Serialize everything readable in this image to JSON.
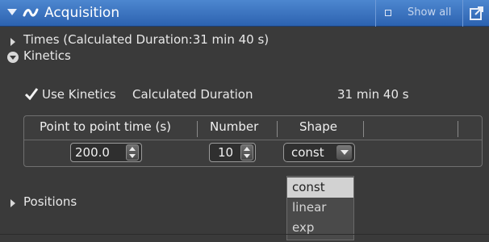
{
  "panel": {
    "title": "Acquisition",
    "show_all_label": "Show all"
  },
  "tree": {
    "times_label": "Times (Calculated Duration:31 min 40 s)",
    "kinetics_label": "Kinetics",
    "positions_label": "Positions"
  },
  "kinetics": {
    "use_kinetics_label": "Use Kinetics",
    "use_kinetics_checked": true,
    "calc_duration_label": "Calculated Duration",
    "calc_duration_value": "31 min 40 s"
  },
  "table": {
    "headers": [
      "Point to point time (s)",
      "Number",
      "Shape"
    ],
    "rows": [
      {
        "point_time": "200.0",
        "number": "10",
        "shape": "const"
      }
    ]
  },
  "shape_dropdown": {
    "options": [
      "const",
      "linear",
      "exp"
    ],
    "selected": "const"
  },
  "colors": {
    "titlebar": "#3570bd",
    "panel_bg": "#3a3a3a",
    "selected_option_bg": "#d2d2d2"
  }
}
